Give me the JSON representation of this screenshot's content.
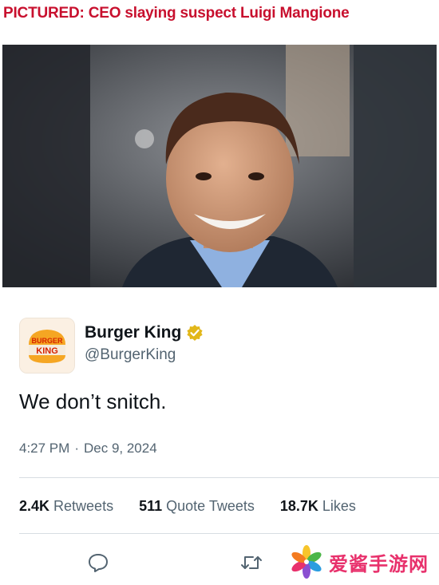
{
  "headline": "PICTURED: CEO slaying suspect Luigi Mangione",
  "photo": {
    "icon": "portrait-photo"
  },
  "tweet": {
    "display_name": "Burger King",
    "handle": "@BurgerKing",
    "verified_icon": "verified-badge-icon",
    "avatar_logo_text_top": "BURGER",
    "avatar_logo_text_bottom": "KING",
    "text": "We don’t snitch.",
    "time": "4:27 PM",
    "separator": "·",
    "date": "Dec 9, 2024",
    "stats": [
      {
        "count": "2.4K",
        "label": "Retweets"
      },
      {
        "count": "511",
        "label": "Quote Tweets"
      },
      {
        "count": "18.7K",
        "label": "Likes"
      }
    ],
    "actions": [
      {
        "icon": "reply-icon"
      },
      {
        "icon": "retweet-icon"
      }
    ]
  },
  "watermark": {
    "text": "爱酱手游网"
  },
  "colors": {
    "headline": "#c8102e",
    "verified_gold": "#e2b719",
    "secondary_text": "#536471",
    "burger_king_red": "#d62300",
    "burger_king_orange": "#f5a623"
  }
}
